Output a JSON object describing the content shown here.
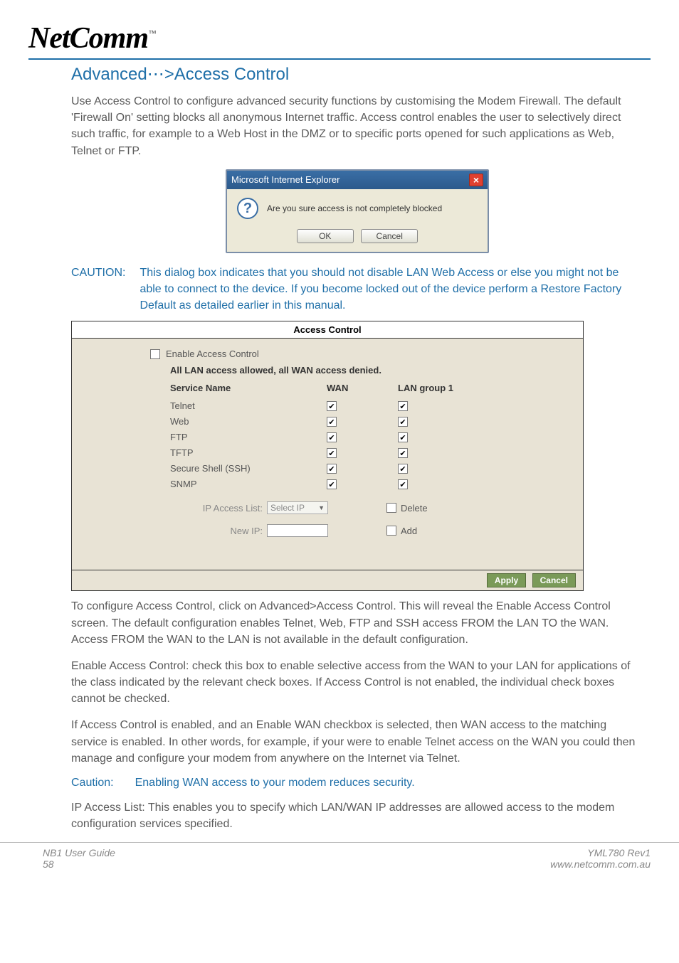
{
  "logo": {
    "brand": "NetComm",
    "tm": "™"
  },
  "heading": "Advanced⋯>Access Control",
  "paragraphs": {
    "intro": "Use Access Control to configure advanced security functions by customising the Modem Firewall.  The default 'Firewall On' setting blocks all anonymous Internet traffic.  Access control enables the user to selectively direct such traffic, for example to a Web Host in the DMZ or to specific ports opened for such applications as Web, Telnet or FTP.",
    "afterPanel1": "To configure Access Control, click on Advanced>Access Control.  This will reveal the Enable Access Control screen.  The default configuration enables Telnet, Web, FTP and SSH access FROM the LAN TO the WAN.  Access FROM the WAN to the LAN is not available in the default configuration.",
    "afterPanel2": "Enable Access Control: check this box to enable selective access from the WAN to your LAN for applications of the class indicated by the relevant check boxes. If Access Control is not enabled, the individual check boxes cannot be checked.",
    "afterPanel3": "If Access Control is enabled, and an Enable WAN checkbox is selected, then WAN access to the matching service is enabled.  In other words, for example, if your were to enable Telnet access on the WAN you could then manage and configure your modem from anywhere on the Internet via Telnet.",
    "afterCaution": "IP Access List: This enables you to specify which LAN/WAN IP addresses are allowed access to the modem configuration services specified."
  },
  "ieDialog": {
    "title": "Microsoft Internet Explorer",
    "message": "Are you sure access is not completely blocked",
    "ok": "OK",
    "cancel": "Cancel",
    "icon": "?"
  },
  "cautionBlock": {
    "label": "CAUTION:",
    "text": "This dialog box indicates that you should not disable LAN Web Access or else you might not be able to connect to the device. If you become locked out of the device  perform a Restore Factory Default as detailed earlier in this manual."
  },
  "accessControl": {
    "title": "Access Control",
    "enableLabel": "Enable Access Control",
    "subheading": "All LAN access allowed, all WAN access denied.",
    "columns": {
      "name": "Service Name",
      "wan": "WAN",
      "lan": "LAN group 1"
    },
    "services": [
      {
        "name": "Telnet",
        "wan": true,
        "lan": true
      },
      {
        "name": "Web",
        "wan": true,
        "lan": true
      },
      {
        "name": "FTP",
        "wan": true,
        "lan": true
      },
      {
        "name": "TFTP",
        "wan": true,
        "lan": true
      },
      {
        "name": "Secure Shell (SSH)",
        "wan": true,
        "lan": true
      },
      {
        "name": "SNMP",
        "wan": true,
        "lan": true
      }
    ],
    "ipListLabel": "IP Access List:",
    "ipListSelected": "Select IP",
    "deleteLabel": "Delete",
    "newIpLabel": "New IP:",
    "addLabel": "Add",
    "apply": "Apply",
    "cancel": "Cancel"
  },
  "inlineCaution": {
    "label": "Caution:",
    "text": "Enabling WAN access to your modem reduces security."
  },
  "footer": {
    "leftTop": "NB1 User Guide",
    "leftBottom": "58",
    "rightTop": "YML780 Rev1",
    "rightBottom": "www.netcomm.com.au"
  }
}
